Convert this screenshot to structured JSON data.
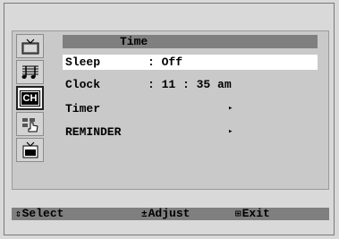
{
  "menu": {
    "title": "Time",
    "items": [
      {
        "label": "Sleep",
        "value": ": Off"
      },
      {
        "label": "Clock",
        "value": ": 11 : 35 am"
      },
      {
        "label": "Timer",
        "value": "▸"
      },
      {
        "label": "REMINDER",
        "value": "▸"
      }
    ]
  },
  "sidebar": {
    "icons": [
      "picture-icon",
      "sound-icon",
      "channel-icon",
      "setup-icon",
      "input-icon"
    ],
    "channel_text": "CH"
  },
  "footer": {
    "select_glyph": "⇕",
    "select_label": "Select",
    "adjust_glyph": "±",
    "adjust_label": "Adjust",
    "exit_glyph": "⊞",
    "exit_label": "Exit"
  },
  "colors": {
    "highlight": "#ffffff",
    "bar": "#7f7f7f",
    "panel": "#c9c9c9"
  }
}
